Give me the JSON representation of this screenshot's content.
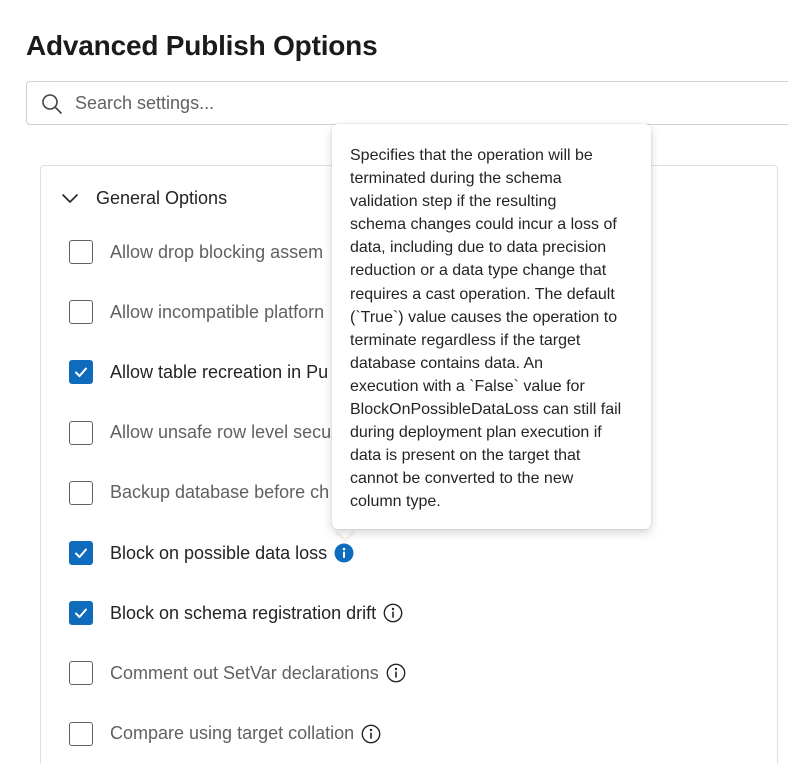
{
  "page": {
    "title": "Advanced Publish Options"
  },
  "search": {
    "placeholder": "Search settings...",
    "value": "",
    "icon": "search-icon"
  },
  "section": {
    "title": "General Options",
    "expanded": true,
    "icon": "chevron-down-icon"
  },
  "options": [
    {
      "label": "Allow drop blocking assem",
      "checked": false,
      "enabled": false,
      "has_info": false
    },
    {
      "label": "Allow incompatible platforn",
      "checked": false,
      "enabled": false,
      "has_info": false
    },
    {
      "label": "Allow table recreation in Pu",
      "checked": true,
      "enabled": true,
      "has_info": false
    },
    {
      "label": "Allow unsafe row level secu",
      "checked": false,
      "enabled": false,
      "has_info": false
    },
    {
      "label": "Backup database before ch",
      "checked": false,
      "enabled": false,
      "has_info": false
    },
    {
      "label": "Block on possible data loss",
      "checked": true,
      "enabled": true,
      "has_info": true,
      "info_active": true
    },
    {
      "label": "Block on schema registration drift",
      "checked": true,
      "enabled": true,
      "has_info": true,
      "info_active": false
    },
    {
      "label": "Comment out SetVar declarations",
      "checked": false,
      "enabled": false,
      "has_info": true,
      "info_active": false
    },
    {
      "label": "Compare using target collation",
      "checked": false,
      "enabled": false,
      "has_info": true,
      "info_active": false
    }
  ],
  "tooltip": {
    "lines": [
      "Specifies that the operation will be",
      "terminated during the schema",
      "validation step if the resulting",
      "schema changes could incur a loss of",
      "data, including due to data precision",
      "reduction or a data type change that",
      "requires a cast operation. The default",
      "(`True`) value causes the operation to",
      "terminate regardless if the target",
      "database contains data. An",
      "execution with a `False` value for",
      "BlockOnPossibleDataLoss can still fail",
      "during deployment plan execution if",
      "data is present on the target that",
      "cannot be converted to the new",
      "column type."
    ]
  },
  "colors": {
    "accent": "#0f6cbd",
    "text": "#242424",
    "muted_text": "#616161",
    "border": "#e0e0e0"
  }
}
